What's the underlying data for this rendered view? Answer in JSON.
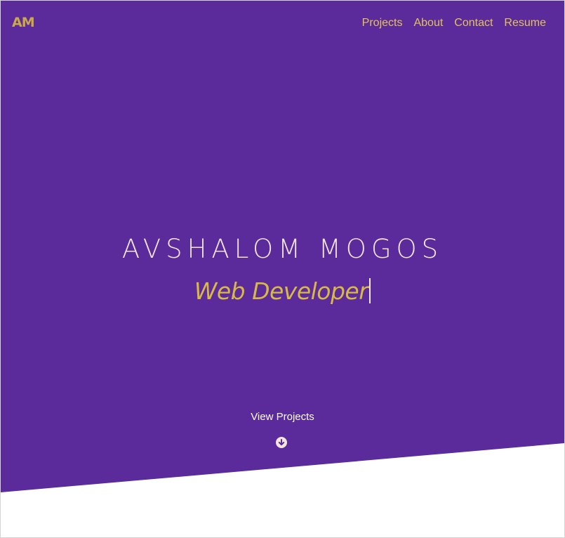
{
  "logo": "AM",
  "nav": {
    "items": [
      "Projects",
      "About",
      "Contact",
      "Resume"
    ]
  },
  "hero": {
    "name": "AVSHALOM MOGOS",
    "role": "Web Developer",
    "cta_label": "View Projects",
    "cta_icon": "arrow-down-circle-icon"
  },
  "colors": {
    "hero_background": "#5b2a9b",
    "accent_gold": "#e3c35a",
    "name_text": "#f1e3e0",
    "page_background": "#ffffff"
  }
}
